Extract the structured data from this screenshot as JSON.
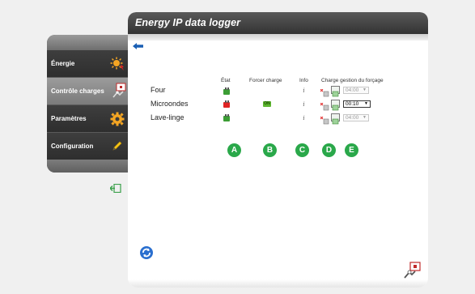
{
  "window": {
    "title": "Energy IP data logger"
  },
  "sidebar": {
    "items": [
      {
        "label": "Énergie",
        "icon": "energy-icon",
        "active": false
      },
      {
        "label": "Contrôle charges",
        "icon": "load-control-icon",
        "active": true
      },
      {
        "label": "Paramètres",
        "icon": "gear-icon",
        "active": false
      },
      {
        "label": "Configuration",
        "icon": "pencil-icon",
        "active": false
      }
    ]
  },
  "table": {
    "headers": {
      "etat": "État",
      "forcer": "Forcer charge",
      "info": "Info",
      "gestion": "Charge gestion du forçage"
    },
    "rows": [
      {
        "name": "Four",
        "status": "connected",
        "force_label": "",
        "time": "04:00",
        "time_active": false
      },
      {
        "name": "Microondes",
        "status": "disconnected",
        "force_label": "ON",
        "time": "00:10",
        "time_active": true
      },
      {
        "name": "Lave-linge",
        "status": "connected",
        "force_label": "",
        "time": "04:00",
        "time_active": false
      }
    ]
  },
  "callouts": [
    "A",
    "B",
    "C",
    "D",
    "E"
  ],
  "colors": {
    "header_dark": "#333333",
    "callout_green": "#2aa84a",
    "status_green": "#3b9d34",
    "status_red": "#e02424",
    "arrow_blue": "#1a5fb4"
  }
}
